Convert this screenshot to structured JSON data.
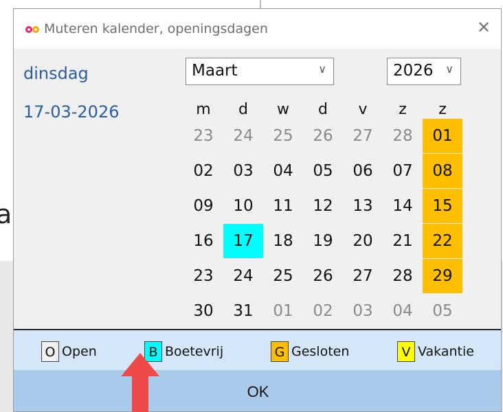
{
  "window": {
    "title": "Muteren kalender, openingsdagen"
  },
  "selected": {
    "day_name": "dinsdag",
    "date": "17-03-2026"
  },
  "month_select": {
    "value": "Maart"
  },
  "year_select": {
    "value": "2026"
  },
  "weekdays": [
    "m",
    "d",
    "w",
    "d",
    "v",
    "z",
    "z"
  ],
  "weeks": [
    [
      {
        "d": "23",
        "o": 1
      },
      {
        "d": "24",
        "o": 1
      },
      {
        "d": "25",
        "o": 1
      },
      {
        "d": "26",
        "o": 1
      },
      {
        "d": "27",
        "o": 1
      },
      {
        "d": "28",
        "o": 1
      },
      {
        "d": "01",
        "s": "G"
      }
    ],
    [
      {
        "d": "02"
      },
      {
        "d": "03"
      },
      {
        "d": "04"
      },
      {
        "d": "05"
      },
      {
        "d": "06"
      },
      {
        "d": "07"
      },
      {
        "d": "08",
        "s": "G"
      }
    ],
    [
      {
        "d": "09"
      },
      {
        "d": "10"
      },
      {
        "d": "11"
      },
      {
        "d": "12"
      },
      {
        "d": "13"
      },
      {
        "d": "14"
      },
      {
        "d": "15",
        "s": "G"
      }
    ],
    [
      {
        "d": "16"
      },
      {
        "d": "17",
        "s": "B"
      },
      {
        "d": "18"
      },
      {
        "d": "19"
      },
      {
        "d": "20"
      },
      {
        "d": "21"
      },
      {
        "d": "22",
        "s": "G"
      }
    ],
    [
      {
        "d": "23"
      },
      {
        "d": "24"
      },
      {
        "d": "25"
      },
      {
        "d": "26"
      },
      {
        "d": "27"
      },
      {
        "d": "28"
      },
      {
        "d": "29",
        "s": "G"
      }
    ],
    [
      {
        "d": "30"
      },
      {
        "d": "31"
      },
      {
        "d": "01",
        "o": 1
      },
      {
        "d": "02",
        "o": 1
      },
      {
        "d": "03",
        "o": 1
      },
      {
        "d": "04",
        "o": 1
      },
      {
        "d": "05",
        "o": 1
      }
    ]
  ],
  "legend": [
    {
      "code": "O",
      "label": "Open",
      "color": "#f0f0f0"
    },
    {
      "code": "B",
      "label": "Boetevrij",
      "color": "#00ffff"
    },
    {
      "code": "G",
      "label": "Gesloten",
      "color": "#ffbf00"
    },
    {
      "code": "V",
      "label": "Vakantie",
      "color": "#ffff00"
    }
  ],
  "ok_label": "OK",
  "icons": {
    "app": "infinity-logo-icon",
    "close": "close-icon",
    "dropdown": "chevron-down-icon",
    "annotation": "red-arrow-icon"
  }
}
